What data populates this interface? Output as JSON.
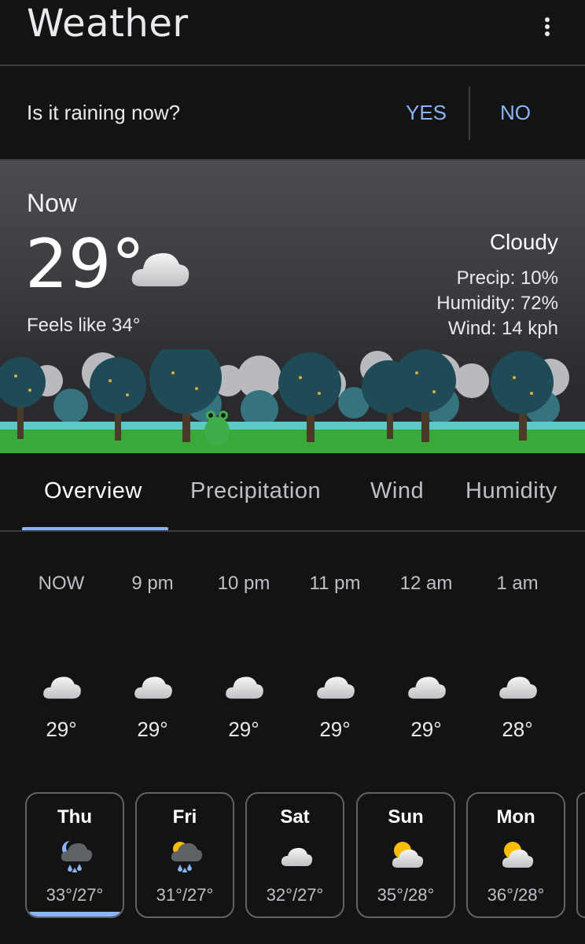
{
  "header": {
    "title": "Weather"
  },
  "rain_prompt": {
    "question": "Is it raining now?",
    "yes_label": "YES",
    "no_label": "NO"
  },
  "current": {
    "label": "Now",
    "temp": "29°",
    "icon": "cloudy-icon",
    "feels_like": "Feels like 34°",
    "condition": "Cloudy",
    "precip": "Precip: 10%",
    "humidity": "Humidity: 72%",
    "wind": "Wind: 14 kph"
  },
  "tabs": [
    {
      "label": "Overview"
    },
    {
      "label": "Precipitation"
    },
    {
      "label": "Wind"
    },
    {
      "label": "Humidity"
    }
  ],
  "hourly": [
    {
      "time": "NOW",
      "temp": "29°",
      "icon": "cloudy-icon"
    },
    {
      "time": "9 pm",
      "temp": "29°",
      "icon": "cloudy-icon"
    },
    {
      "time": "10 pm",
      "temp": "29°",
      "icon": "cloudy-icon"
    },
    {
      "time": "11 pm",
      "temp": "29°",
      "icon": "cloudy-icon"
    },
    {
      "time": "12 am",
      "temp": "29°",
      "icon": "cloudy-icon"
    },
    {
      "time": "1 am",
      "temp": "28°",
      "icon": "cloudy-icon"
    }
  ],
  "daily": [
    {
      "day": "Thu",
      "range": "33°/27°",
      "icon": "night-rain-icon",
      "selected": true
    },
    {
      "day": "Fri",
      "range": "31°/27°",
      "icon": "partly-sunny-rain-icon",
      "selected": false
    },
    {
      "day": "Sat",
      "range": "32°/27°",
      "icon": "cloudy-icon",
      "selected": false
    },
    {
      "day": "Sun",
      "range": "35°/28°",
      "icon": "partly-sunny-icon",
      "selected": false
    },
    {
      "day": "Mon",
      "range": "36°/28°",
      "icon": "partly-sunny-icon",
      "selected": false
    }
  ],
  "colors": {
    "accent": "#8ab4f8",
    "background": "#131314",
    "divider": "#3c3c3e"
  }
}
